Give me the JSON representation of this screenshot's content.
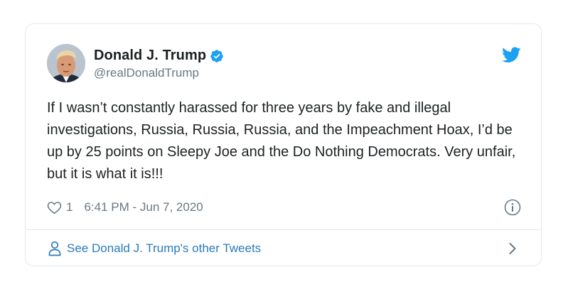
{
  "tweet": {
    "author": {
      "display_name": "Donald J. Trump",
      "handle": "@realDonaldTrump",
      "verified": true,
      "avatar_icon": "profile-photo"
    },
    "text": "If I wasn’t constantly harassed for three years by fake and illegal investigations, Russia, Russia, Russia, and the Impeachment Hoax, I’d be up by 25 points on Sleepy Joe and the Do Nothing Democrats. Very unfair, but it is what it is!!!",
    "like_count": "1",
    "timestamp": "6:41 PM - Jun 7, 2020"
  },
  "footer": {
    "link_text": "See Donald J. Trump's other Tweets"
  },
  "icons": {
    "brand": "twitter-bird-icon",
    "verified": "verified-badge-icon",
    "like": "heart-icon",
    "info": "info-icon",
    "person": "person-icon",
    "chevron": "chevron-right-icon"
  },
  "colors": {
    "brand_blue": "#1da1f2",
    "link_blue": "#2b7bb9",
    "text_primary": "#1c2022",
    "text_secondary": "#697882",
    "border": "#e1e8ed"
  }
}
